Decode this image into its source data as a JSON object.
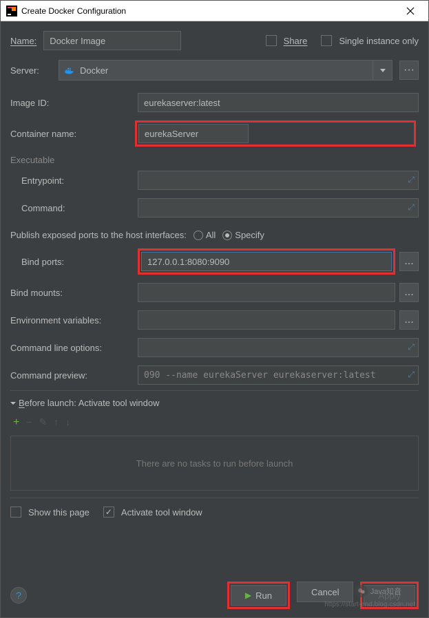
{
  "window": {
    "title": "Create Docker Configuration"
  },
  "top": {
    "name_label": "Name:",
    "name_value": "Docker Image",
    "share_label": "Share",
    "single_instance_label": "Single instance only"
  },
  "server": {
    "label": "Server:",
    "value": "Docker",
    "more_label": "···"
  },
  "image": {
    "label": "Image ID:",
    "value": "eurekaserver:latest"
  },
  "container": {
    "label": "Container name:",
    "value": "eurekaServer"
  },
  "executable": {
    "header": "Executable",
    "entrypoint_label": "Entrypoint:",
    "entrypoint_value": "",
    "command_label": "Command:",
    "command_value": ""
  },
  "ports": {
    "publish_label": "Publish exposed ports to the host interfaces:",
    "all_label": "All",
    "specify_label": "Specify",
    "bind_label": "Bind ports:",
    "bind_value": "127.0.0.1:8080:9090",
    "more": "..."
  },
  "mounts": {
    "label": "Bind mounts:",
    "value": "",
    "more": "..."
  },
  "env": {
    "label": "Environment variables:",
    "value": "",
    "more": "..."
  },
  "cmd_options": {
    "label": "Command line options:",
    "value": ""
  },
  "cmd_preview": {
    "label": "Command preview:",
    "value": "090 --name eurekaServer eurekaserver:latest"
  },
  "before_launch": {
    "header": "Before launch: Activate tool window",
    "empty_text": "There are no tasks to run before launch"
  },
  "bottom_checks": {
    "show_page": "Show this page",
    "activate_tw": "Activate tool window"
  },
  "footer": {
    "help": "?",
    "run": "Run",
    "cancel": "Cancel",
    "apply": "Apply"
  },
  "watermark": {
    "url": "https://start-end.blog.csdn.net",
    "badge": "Java知音"
  }
}
